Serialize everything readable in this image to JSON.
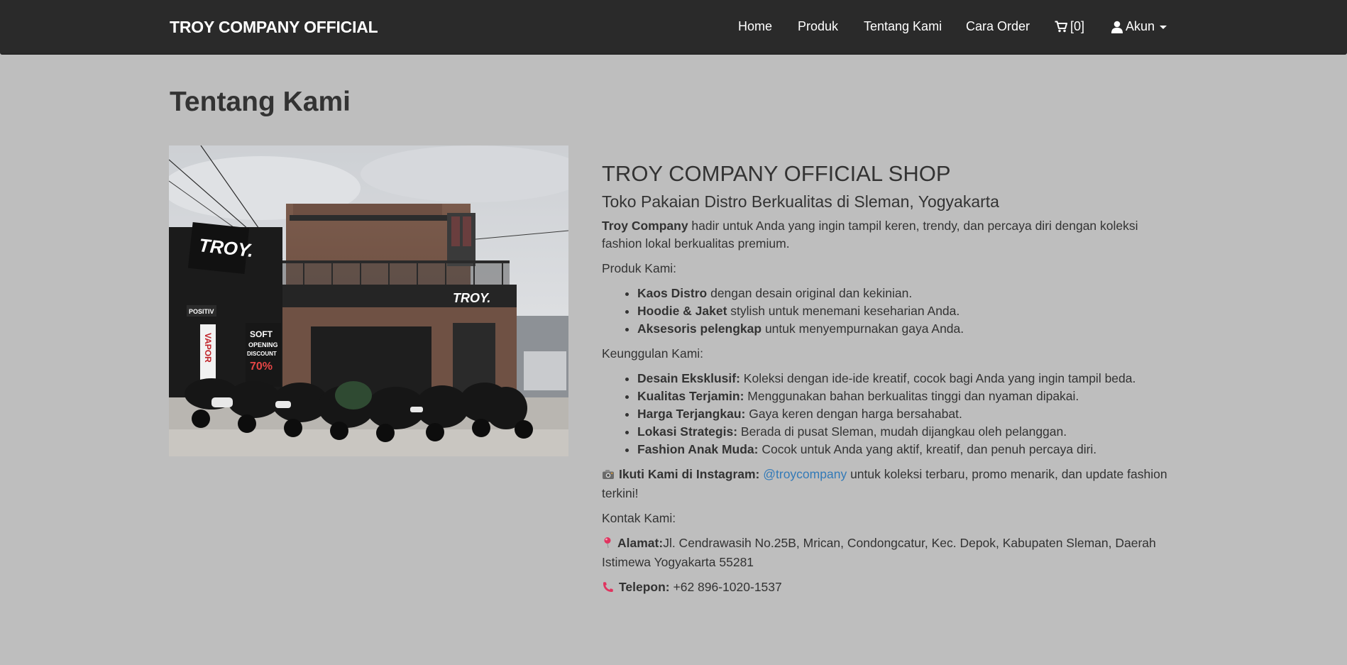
{
  "nav": {
    "brand": "TROY COMPANY OFFICIAL",
    "home": "Home",
    "produk": "Produk",
    "tentang": "Tentang Kami",
    "cara_order": "Cara Order",
    "cart_count": "[0]",
    "akun": "Akun"
  },
  "page": {
    "title": "Tentang Kami"
  },
  "photo": {
    "sign_main": "TROY.",
    "sign_awning": "TROY.",
    "sign_positiv": "POSITIV",
    "sign_vapor": "VAPOR",
    "banner_line1": "SOFT",
    "banner_line2": "OPENING",
    "banner_line3": "DISCOUNT",
    "banner_line4": "70%"
  },
  "about": {
    "title": "TROY COMPANY OFFICIAL SHOP",
    "subtitle": "Toko Pakaian Distro Berkualitas di Sleman, Yogyakarta",
    "intro_bold": "Troy Company",
    "intro_rest": " hadir untuk Anda yang ingin tampil keren, trendy, dan percaya diri dengan koleksi fashion lokal berkualitas premium.",
    "produk_heading": "Produk Kami:",
    "produk": [
      {
        "bold": "Kaos Distro",
        "text": " dengan desain original dan kekinian."
      },
      {
        "bold": "Hoodie & Jaket",
        "text": " stylish untuk menemani keseharian Anda."
      },
      {
        "bold": "Aksesoris pelengkap",
        "text": " untuk menyempurnakan gaya Anda."
      }
    ],
    "keunggulan_heading": "Keunggulan Kami:",
    "keunggulan": [
      {
        "bold": "Desain Eksklusif:",
        "text": " Koleksi dengan ide-ide kreatif, cocok bagi Anda yang ingin tampil beda."
      },
      {
        "bold": "Kualitas Terjamin:",
        "text": " Menggunakan bahan berkualitas tinggi dan nyaman dipakai."
      },
      {
        "bold": "Harga Terjangkau:",
        "text": " Gaya keren dengan harga bersahabat."
      },
      {
        "bold": "Lokasi Strategis:",
        "text": " Berada di pusat Sleman, mudah dijangkau oleh pelanggan."
      },
      {
        "bold": "Fashion Anak Muda:",
        "text": " Cocok untuk Anda yang aktif, kreatif, dan penuh percaya diri."
      }
    ],
    "instagram_bold": "Ikuti Kami di Instagram:",
    "instagram_handle": "@troycompany",
    "instagram_rest": " untuk koleksi terbaru, promo menarik, dan update fashion terkini!",
    "kontak_heading": "Kontak Kami:",
    "alamat_bold": "Alamat:",
    "alamat_text": "Jl. Cendrawasih No.25B, Mrican, Condongcatur, Kec. Depok, Kabupaten Sleman, Daerah Istimewa Yogyakarta 55281",
    "telepon_bold": "Telepon:",
    "telepon_text": " +62 896-1020-1537"
  },
  "icons": {
    "cart": "cart-icon",
    "user": "user-icon",
    "camera": "camera-icon",
    "pin": "pin-icon",
    "phone": "phone-icon"
  }
}
